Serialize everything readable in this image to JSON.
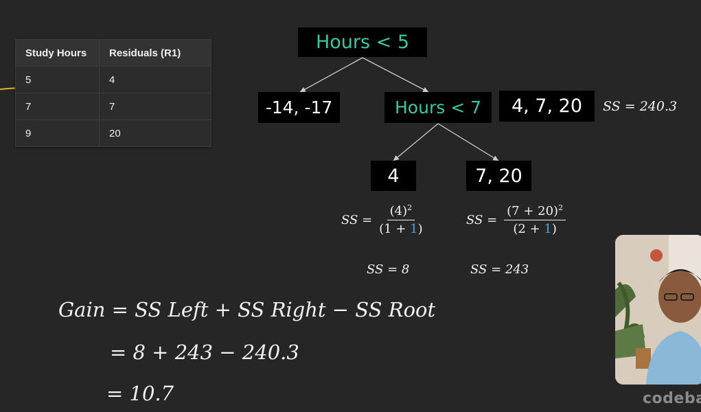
{
  "table": {
    "headers": [
      "Study Hours",
      "Residuals (R1)"
    ],
    "rows": [
      [
        "5",
        "4"
      ],
      [
        "7",
        "7"
      ],
      [
        "9",
        "20"
      ]
    ]
  },
  "tree": {
    "root": "Hours < 5",
    "left_leaf": "-14, -17",
    "mid_node": "Hours < 7",
    "right_values": "4, 7, 20",
    "right_values_ss": "SS  = 240.3",
    "leaf_a": "4",
    "leaf_b": "7, 20"
  },
  "formulas": {
    "ss_label": "SS =",
    "ss_left_num": "(4)",
    "ss_left_num_exp": "2",
    "ss_left_den_pre": "(1 + ",
    "ss_left_den_lambda": "1",
    "ss_left_den_post": ")",
    "ss_right_num": "(7 + 20)",
    "ss_right_num_exp": "2",
    "ss_right_den_pre": "(2 + ",
    "ss_right_den_lambda": "1",
    "ss_right_den_post": ")",
    "ss_left_result": "SS  = 8",
    "ss_right_result": "SS  = 243"
  },
  "gain": {
    "line1": "Gain = SS Left + SS Right − SS Root",
    "line2": "= 8 + 243  − 240.3",
    "line3": "= 10.7"
  },
  "brand": "codeba",
  "colors": {
    "teal": "#3cc7a6",
    "blue": "#4aa5e8",
    "background": "#262626",
    "node_bg": "#000000"
  }
}
